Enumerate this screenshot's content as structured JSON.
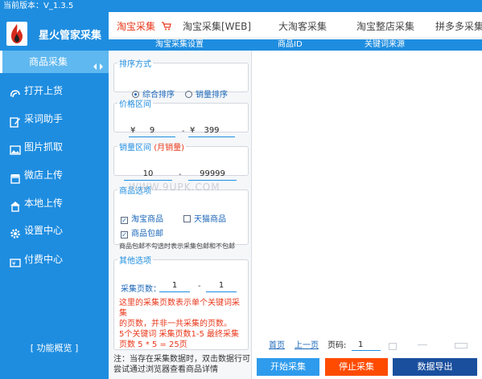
{
  "version": "当前版本：V_1.3.5",
  "app": {
    "title": "星火管家采集"
  },
  "sidebar": {
    "items": [
      {
        "label": "商品采集",
        "icon": "collect-icon"
      },
      {
        "label": "打开上货",
        "icon": "upload-icon"
      },
      {
        "label": "采词助手",
        "icon": "edit-icon"
      },
      {
        "label": "图片抓取",
        "icon": "image-icon"
      },
      {
        "label": "微店上传",
        "icon": "store-icon"
      },
      {
        "label": "本地上传",
        "icon": "shop-icon"
      },
      {
        "label": "设置中心",
        "icon": "gear-icon"
      },
      {
        "label": "付费中心",
        "icon": "payment-icon"
      }
    ],
    "footer": "[ 功能概览 ]"
  },
  "tabs": [
    {
      "label": "淘宝采集",
      "active": true
    },
    {
      "label": "淘宝采集[WEB]"
    },
    {
      "label": "大淘客采集"
    },
    {
      "label": "淘宝整店采集"
    },
    {
      "label": "拼多多采集"
    }
  ],
  "subheaders": {
    "settings": "淘宝采集设置",
    "col_id": "商品ID",
    "col_source": "关键词来源"
  },
  "sort": {
    "legend": "排序方式",
    "options": [
      "综合排序",
      "销量排序"
    ],
    "selected": 0
  },
  "price": {
    "legend": "价格区间",
    "currency": "¥",
    "min": "9",
    "max": "399"
  },
  "sales": {
    "legend": "销量区间",
    "legend_red": "(月销量)",
    "min": "10",
    "max": "99999"
  },
  "filter": {
    "legend": "商品选项",
    "options": [
      {
        "label": "淘宝商品",
        "checked": true
      },
      {
        "label": "天猫商品",
        "checked": false
      },
      {
        "label": "商品包邮",
        "checked": true
      }
    ],
    "hint": "商品包邮不勾选时表示采集包邮和不包邮"
  },
  "other": {
    "legend": "其他选项",
    "pages_label": "采集页数：",
    "page_from": "1",
    "page_to": "1",
    "note_lines": [
      "这里的采集页数表示单个关键词采集",
      "的页数，并非一共采集的页数。",
      "5个关键词  采集页数1-5 最终采集",
      "页数 5 * 5 = 25页"
    ]
  },
  "footnote_lines": [
    "注：当存在采集数据时，双击数据行可",
    "尝试通过浏览器查看商品详情"
  ],
  "pager": {
    "first": "首页",
    "prev": "上一页",
    "page_label": "页码:",
    "page_value": "1"
  },
  "buttons": {
    "start": "开始采集",
    "stop": "停止采集",
    "export": "数据导出",
    "colors": {
      "start": "#2e9bec",
      "stop": "#ff4b00",
      "export": "#1a4f9e"
    }
  },
  "watermark": "WWW.9UPK.COM",
  "colors": {
    "primary": "#1e8de0",
    "accent": "#e8381b"
  }
}
